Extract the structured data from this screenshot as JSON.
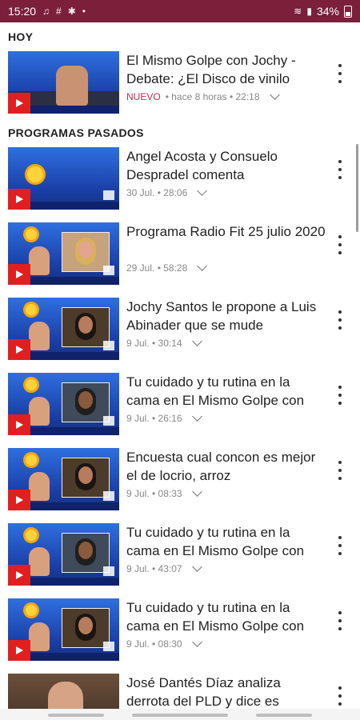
{
  "status_bar": {
    "time": "15:20",
    "battery": "34%",
    "icons_left": [
      "music-note-icon",
      "hash-icon",
      "settings-icon",
      "dot-icon"
    ],
    "icons_right": [
      "wifi-icon",
      "signal-icon",
      "battery-icon"
    ],
    "bar_color": "#7b1f3a"
  },
  "sections": {
    "today": "HOY",
    "past": "PROGRAMAS PASADOS"
  },
  "today_video": {
    "title": "El Mismo Golpe con Jochy - Debate: ¿El Disco de vinilo",
    "badge": "NUEVO",
    "meta": "• hace 8 horas • 22:18"
  },
  "videos": [
    {
      "title": "Angel Acosta y Consuelo Despradel comenta",
      "meta": "30 Jul. • 28:06"
    },
    {
      "title": "Programa Radio Fit 25 julio 2020",
      "meta": "29 Jul. • 58:28"
    },
    {
      "title": "Jochy Santos le propone a Luis Abinader que se mude",
      "meta": "9 Jul. • 30:14"
    },
    {
      "title": "Tu cuidado y tu rutina en la cama en El Mismo Golpe con",
      "meta": "9 Jul. • 26:16"
    },
    {
      "title": "Encuesta cual concon es mejor el de locrio, arroz",
      "meta": "9 Jul. • 08:33"
    },
    {
      "title": "Tu cuidado y tu rutina en la cama en El Mismo Golpe con",
      "meta": "9 Jul. • 43:07"
    },
    {
      "title": "Tu cuidado y tu rutina en la cama en El Mismo Golpe con",
      "meta": "9 Jul. • 08:30"
    },
    {
      "title": "José Dantés Díaz analiza derrota del PLD y dice es",
      "meta": ""
    }
  ],
  "colors": {
    "accent": "#e02020",
    "nuevo": "#d2284a",
    "thumb_blue": "#1d3fa8"
  }
}
